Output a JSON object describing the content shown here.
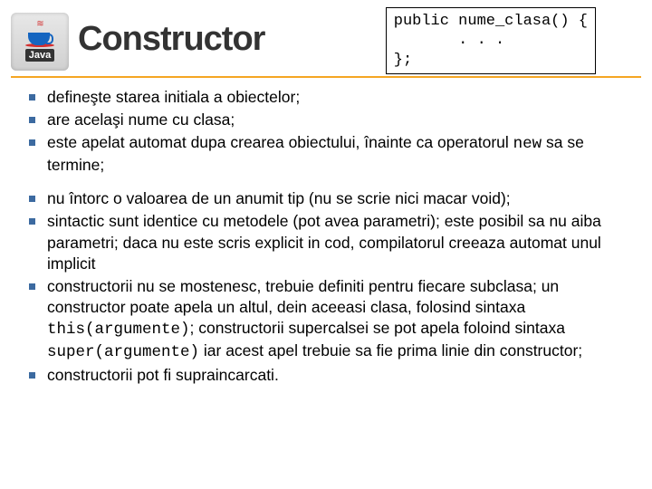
{
  "logo_text": "Java",
  "title": "Constructor",
  "code": {
    "line1": "public nume_clasa() {",
    "line2": "       . . .",
    "line3": "};"
  },
  "group1": {
    "b1": "defineşte starea initiala a obiectelor;",
    "b2": "are acelaşi nume cu clasa;",
    "b3a": "este apelat automat dupa crearea obiectului, înainte ca operatorul ",
    "b3_code": "new",
    "b3b": " sa se termine;"
  },
  "group2": {
    "b4": "nu întorc o valoarea de un anumit tip (nu se scrie nici macar void);",
    "b5": "sintactic sunt identice cu metodele (pot avea parametri); este posibil sa nu aiba parametri; daca nu este scris explicit in cod, compilatorul creeaza automat unul implicit",
    "b6a": "constructorii nu se mostenesc, trebuie definiti pentru fiecare subclasa; un constructor poate apela un altul, dein aceeasi clasa, folosind sintaxa ",
    "b6_code1": "this(argumente)",
    "b6b": "; constructorii supercalsei se pot apela foloind sintaxa ",
    "b6_code2": "super(argumente)",
    "b6c": " iar acest apel trebuie sa fie prima linie din constructor;",
    "b7": "constructorii pot fi supraincarcati."
  }
}
